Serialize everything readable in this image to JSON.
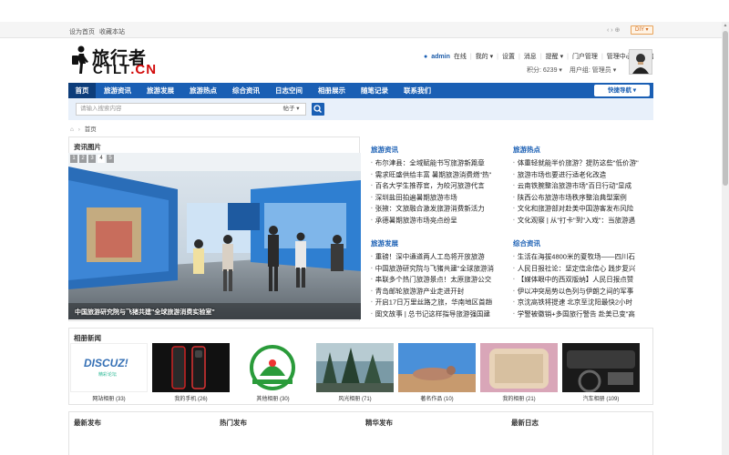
{
  "topbar": {
    "links": [
      "设为首页",
      "收藏本站"
    ],
    "icons": "‹ › ⊕",
    "diy": "DIY ▾"
  },
  "logo": {
    "cn": "旅行者",
    "en_main": "CTLT",
    "en_suffix": ".CN"
  },
  "user": {
    "name": "admin",
    "status": "在线",
    "menu": [
      "我的 ▾",
      "设置",
      "消息",
      "提醒 ▾",
      "门户管理",
      "管理中心",
      "退出"
    ],
    "points": "积分: 6239 ▾",
    "group": "用户组: 管理员 ▾"
  },
  "nav": {
    "items": [
      "首页",
      "旅游资讯",
      "旅游发展",
      "旅游热点",
      "综合资讯",
      "日志空间",
      "相册展示",
      "随笔记录",
      "联系我们"
    ],
    "quick": "快捷导航 ▾"
  },
  "search": {
    "placeholder": "请输入搜索内容",
    "type": "帖子 ▾"
  },
  "breadcrumb": {
    "sep": "›",
    "home": "首页"
  },
  "slideshow": {
    "title": "资讯图片",
    "numbers": [
      "1",
      "2",
      "3",
      "4",
      "5"
    ],
    "active": 3,
    "caption": "中国旅游研究院与飞猪共建\"全球旅游消费实验室\""
  },
  "columns": [
    {
      "title": "旅游资讯",
      "items": [
        "布尔津县：全域赋能书写旅游新篇章",
        "需求旺盛供给丰富 暑期旅游消费燃\"热\"",
        "百名大学生推荐官，为皎河旅游代言",
        "深圳盐田拍遍暑期旅游市场",
        "张掖：文旅融合激发旅游消费新活力",
        "承德暑期旅游市场亮点纷呈"
      ]
    },
    {
      "title": "旅游热点",
      "items": [
        "体重轻就能半价旅游？提防这些\"低价游\"",
        "旅游市场也要进行适老化改造",
        "云南铁腕整治旅游市场\"百日行动\"显成",
        "陕西公布旅游市场秩序整治典型案例",
        "文化和旅游部对赴美中国游客发布风险",
        "文化观察 | 从\"打卡\"到\"入戏\"：当旅游遇"
      ]
    },
    {
      "title": "旅游发展",
      "items": [
        "重磅！深中通道两人工岛将开放旅游",
        "中国旅游研究院与飞猪共建\"全球旅游消",
        "串联多个热门旅游景点！太原旅游公交",
        "青岛邮轮旅游游产业走进开封",
        "开启17日万里丝路之旅，华南地区首趟",
        "图文故事 | 总书记这样指导旅游强国建"
      ]
    },
    {
      "title": "综合资讯",
      "items": [
        "生活在海拔4800米的夏牧场——四川石",
        "人民日报社论：坚定信念信心 践步复兴",
        "【媒体眼中的西双版纳】人民日报点赞",
        "伊以冲突局势以色列与伊朗之间的军事",
        "京沈高铁将提速 北京至沈阳最快2小时",
        "学警被徽销+多国旅行警告 赴美已变\"高"
      ]
    }
  ],
  "albums": {
    "title": "相册新闻",
    "items": [
      {
        "caption": "网站相册 (33)",
        "logo": "DISCUZ!",
        "logo_sub": "精彩论坛"
      },
      {
        "caption": "我的手机 (26)"
      },
      {
        "caption": "其他相册 (30)"
      },
      {
        "caption": "风光相册 (71)"
      },
      {
        "caption": "著名作品 (10)"
      },
      {
        "caption": "我的相册 (21)"
      },
      {
        "caption": "汽车相册 (109)"
      }
    ]
  },
  "bottom": {
    "headers": [
      "最新发布",
      "热门发布",
      "精华发布",
      "最新日志"
    ]
  },
  "colors": {
    "nav": "#1a5fb4",
    "nav_active": "#0d3d7a",
    "accent_red": "#d20a0a",
    "link": "#1a5fb4"
  }
}
